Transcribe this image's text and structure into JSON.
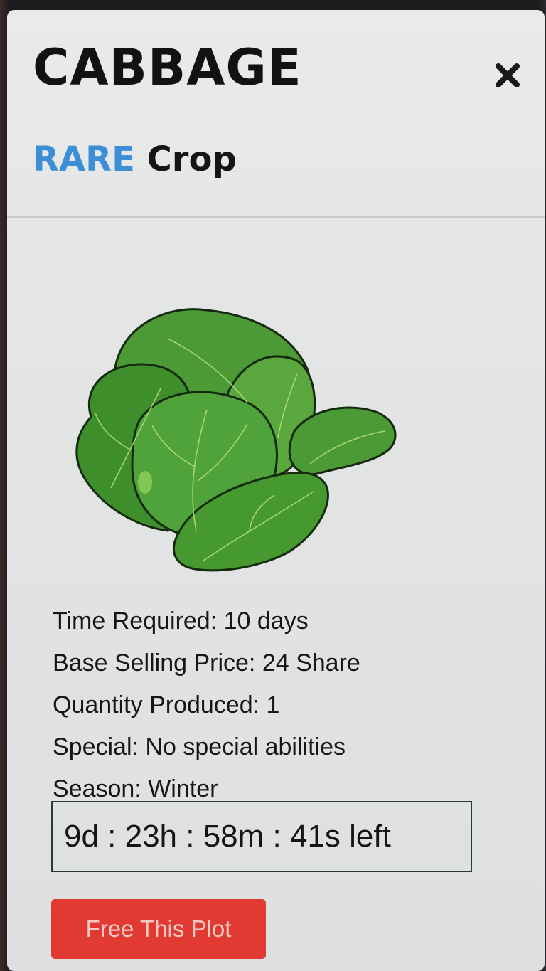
{
  "modal": {
    "title": "CABBAGE",
    "rarity": "RARE",
    "category": "Crop",
    "close_icon": "close-icon",
    "image_icon": "cabbage-illustration"
  },
  "stats": [
    {
      "label": "Time Required:",
      "value": "10 days"
    },
    {
      "label": "Base Selling Price:",
      "value": "24 Share"
    },
    {
      "label": "Quantity Produced:",
      "value": "1"
    },
    {
      "label": "Special:",
      "value": "No special abilities"
    },
    {
      "label": "Season:",
      "value": "Winter"
    }
  ],
  "timer": {
    "text": "9d : 23h : 58m : 41s left"
  },
  "actions": {
    "free_plot_label": "Free This Plot"
  },
  "colors": {
    "rarity": "#3c8fd6",
    "button": "#e03a33",
    "button_text": "#f4c9c4",
    "timer_border": "#2a3d2a"
  }
}
